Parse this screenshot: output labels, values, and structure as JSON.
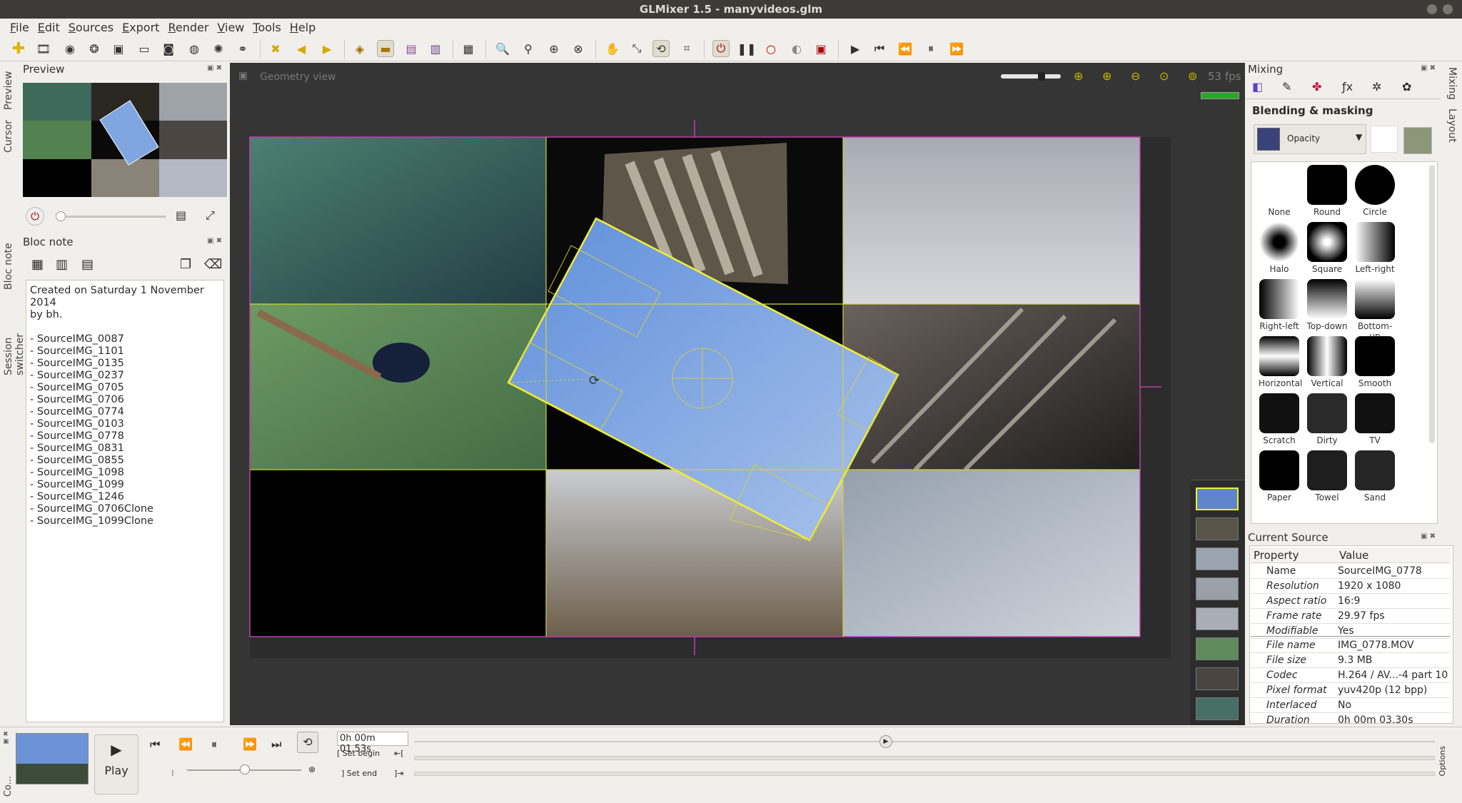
{
  "window": {
    "title": "GLMixer 1.5 - manyvideos.glm"
  },
  "menu": [
    "File",
    "Edit",
    "Sources",
    "Export",
    "Render",
    "View",
    "Tools",
    "Help"
  ],
  "left_tabs": {
    "preview": "Preview",
    "cursor": "Cursor",
    "bloc_note": "Bloc note",
    "session_switcher": "Session switcher",
    "co": "Co..."
  },
  "preview": {
    "title": "Preview"
  },
  "blocnote": {
    "title": "Bloc note",
    "lines": [
      "Created on Saturday 1 November 2014",
      "by bh.",
      "",
      "- SourceIMG_0087",
      "- SourceIMG_1101",
      "- SourceIMG_0135",
      "- SourceIMG_0237",
      "- SourceIMG_0705",
      "- SourceIMG_0706",
      "- SourceIMG_0774",
      "- SourceIMG_0103",
      "- SourceIMG_0778",
      "- SourceIMG_0831",
      "- SourceIMG_0855",
      "- SourceIMG_1098",
      "- SourceIMG_1099",
      "- SourceIMG_1246",
      "- SourceIMG_0706Clone",
      "- SourceIMG_1099Clone"
    ]
  },
  "geometry_view": {
    "title": "Geometry view",
    "fps": "53 fps"
  },
  "right_tabs": {
    "mixing": "Mixing",
    "layout": "Layout"
  },
  "mixing": {
    "title": "Mixing",
    "section": "Blending & masking",
    "blend_mode": "Opacity",
    "masks": [
      "None",
      "Round",
      "Circle",
      "Halo",
      "Square",
      "Left-right",
      "Right-left",
      "Top-down",
      "Bottom-up",
      "Horizontal",
      "Vertical",
      "Smooth",
      "Scratch",
      "Dirty",
      "TV",
      "Paper",
      "Towel",
      "Sand"
    ]
  },
  "current_source": {
    "title": "Current Source",
    "header": {
      "property": "Property",
      "value": "Value"
    },
    "rows": [
      {
        "k": "Name",
        "v": "SourceIMG_0778"
      },
      {
        "k": "Resolution",
        "v": "1920 x 1080"
      },
      {
        "k": "Aspect ratio",
        "v": "16:9"
      },
      {
        "k": "Frame rate",
        "v": "29.97 fps"
      },
      {
        "k": "Modifiable",
        "v": "Yes"
      }
    ],
    "rows2": [
      {
        "k": "File name",
        "v": "IMG_0778.MOV"
      },
      {
        "k": "File size",
        "v": "9.3 MB"
      },
      {
        "k": "Codec",
        "v": "H.264 / AV...-4 part 10"
      },
      {
        "k": "Pixel format",
        "v": "yuv420p (12 bpp)"
      },
      {
        "k": "Interlaced",
        "v": "No"
      },
      {
        "k": "Duration",
        "v": "0h 00m 03.30s"
      }
    ]
  },
  "player": {
    "play_label": "Play",
    "time": "0h 00m 01.53s",
    "set_begin": "Set begin",
    "set_end": "Set end",
    "options": "Options"
  }
}
